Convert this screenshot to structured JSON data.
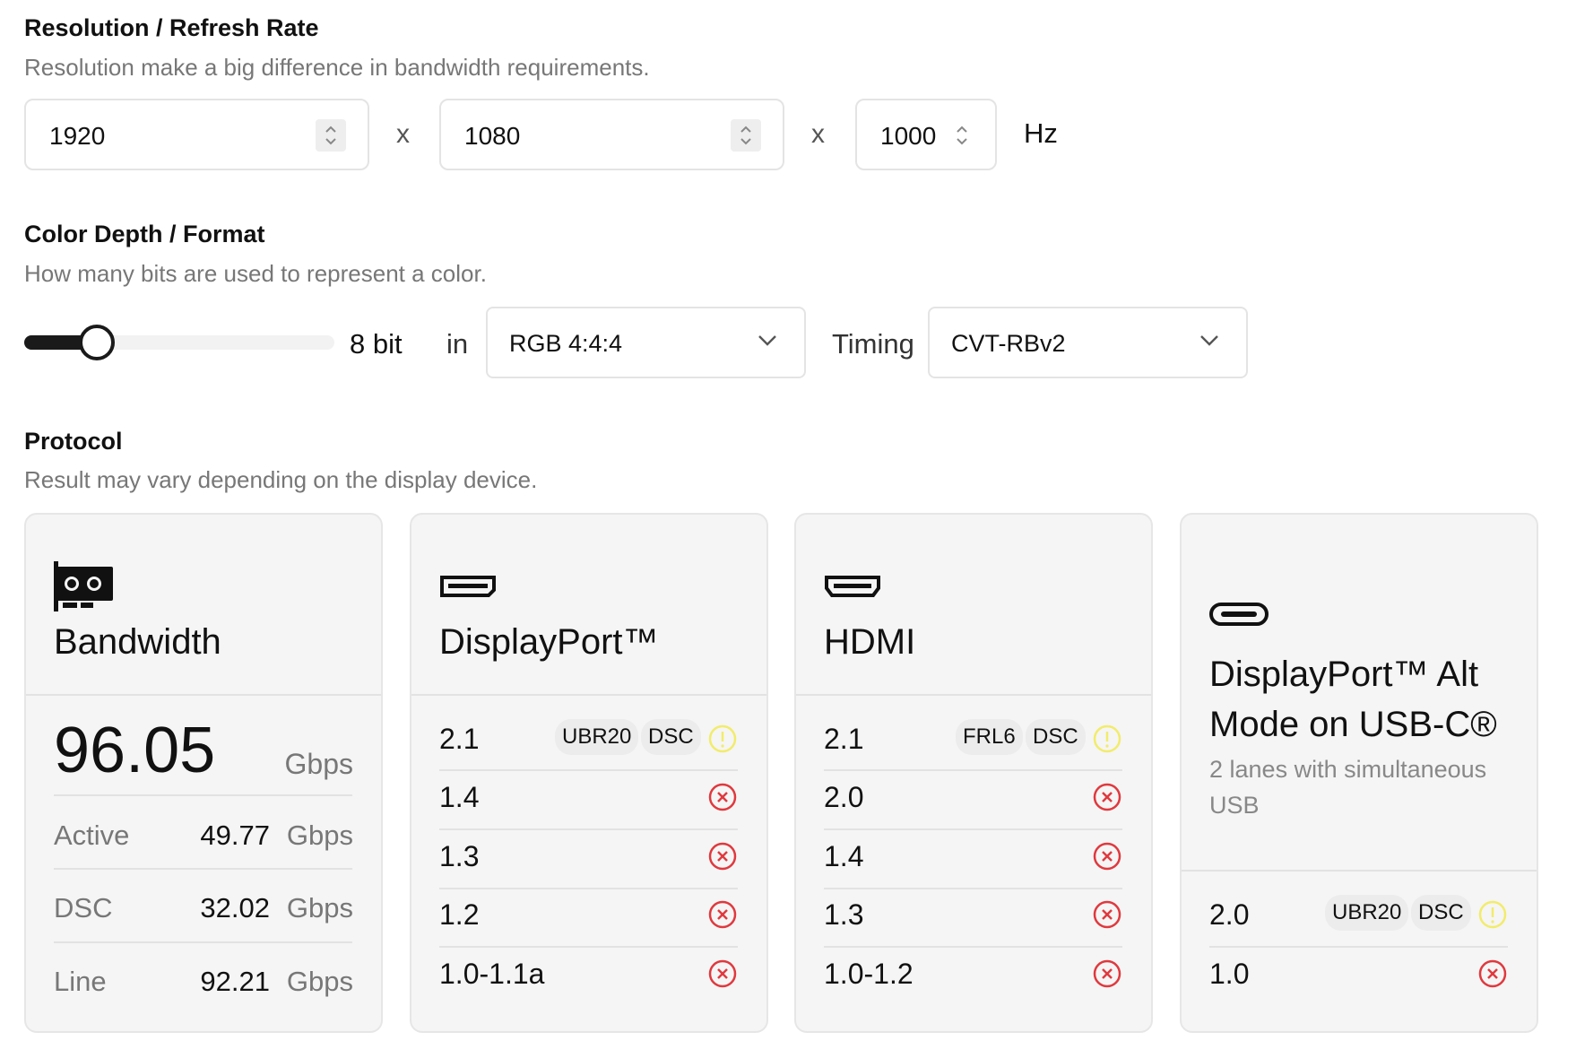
{
  "resolution": {
    "title": "Resolution / Refresh Rate",
    "subtitle": "Resolution make a big difference in bandwidth requirements.",
    "width": "1920",
    "height": "1080",
    "refresh": "1000",
    "times": "x",
    "unit": "Hz"
  },
  "color": {
    "title": "Color Depth / Format",
    "subtitle": "How many bits are used to represent a color.",
    "bit_depth": "8 bit",
    "in_label": "in",
    "format": "RGB 4:4:4",
    "timing_label": "Timing",
    "timing": "CVT-RBv2"
  },
  "protocol": {
    "title": "Protocol",
    "subtitle": "Result may vary depending on the display device."
  },
  "bandwidth": {
    "title": "Bandwidth",
    "total": "96.05",
    "total_unit": "Gbps",
    "rows": [
      {
        "label": "Active",
        "value": "49.77",
        "unit": "Gbps"
      },
      {
        "label": "DSC",
        "value": "32.02",
        "unit": "Gbps"
      },
      {
        "label": "Line",
        "value": "92.21",
        "unit": "Gbps"
      }
    ]
  },
  "displayport": {
    "title": "DisplayPort™",
    "rows": [
      {
        "version": "2.1",
        "tags": [
          "UBR20",
          "DSC"
        ],
        "status": "warning"
      },
      {
        "version": "1.4",
        "status": "fail"
      },
      {
        "version": "1.3",
        "status": "fail"
      },
      {
        "version": "1.2",
        "status": "fail"
      },
      {
        "version": "1.0-1.1a",
        "status": "fail"
      }
    ]
  },
  "hdmi": {
    "title": "HDMI",
    "rows": [
      {
        "version": "2.1",
        "tags": [
          "FRL6",
          "DSC"
        ],
        "status": "warning"
      },
      {
        "version": "2.0",
        "status": "fail"
      },
      {
        "version": "1.4",
        "status": "fail"
      },
      {
        "version": "1.3",
        "status": "fail"
      },
      {
        "version": "1.0-1.2",
        "status": "fail"
      }
    ]
  },
  "usbc": {
    "title": "DisplayPort™ Alt Mode on USB-C®",
    "subtitle": "2 lanes with simultaneous USB",
    "rows": [
      {
        "version": "2.0",
        "tags": [
          "UBR20",
          "DSC"
        ],
        "status": "warning"
      },
      {
        "version": "1.0",
        "status": "fail"
      }
    ]
  },
  "colors": {
    "warning": "#f2ec6b",
    "fail": "#e0393e",
    "text": "#111111",
    "muted": "#777777"
  },
  "icons": {
    "bandwidth": "gpu-card-icon",
    "displayport": "displayport-connector-icon",
    "hdmi": "hdmi-connector-icon",
    "usbc": "usb-c-connector-icon",
    "warning": "warning-circle-icon",
    "fail": "x-circle-icon"
  }
}
